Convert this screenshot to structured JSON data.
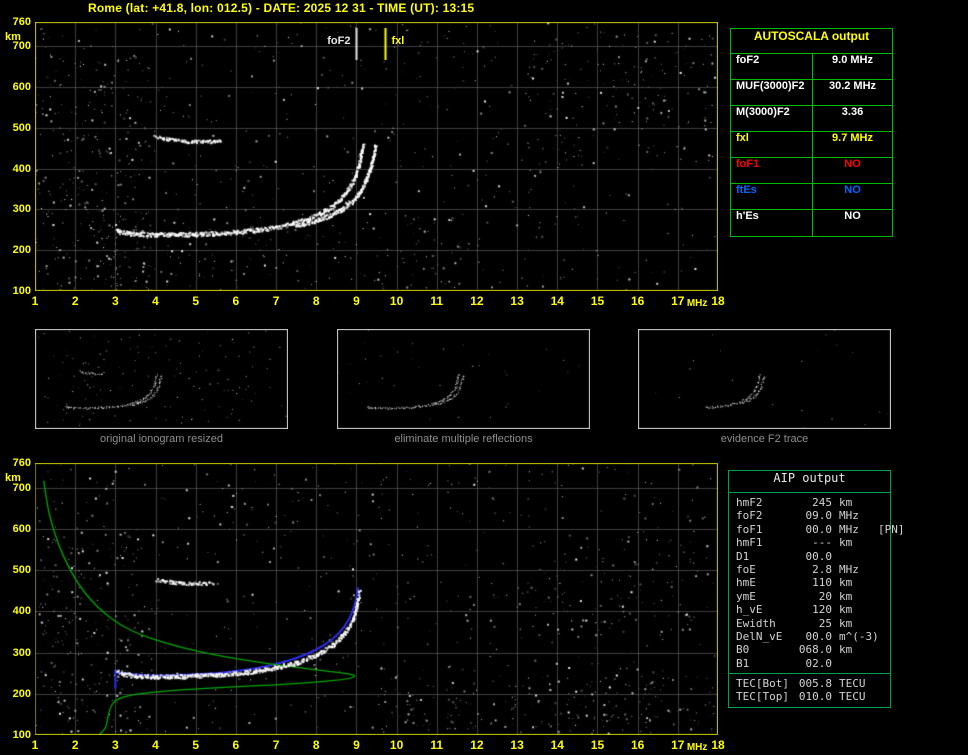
{
  "title": "Rome (lat: +41.8, lon: 012.5) - DATE: 2025 12 31 - TIME (UT): 13:15",
  "colors": {
    "accent_yellow": "#ffff00",
    "table_green": "#00bb00",
    "trace_blue": "#2e2ef0",
    "profile_green": "#00a800",
    "plot_border": "#cdcd00",
    "status_red": "#ff0000",
    "status_blue": "#0066ff"
  },
  "autoscala_table": {
    "header": "AUTOSCALA output",
    "rows": [
      {
        "label": "foF2",
        "value": "9.0 MHz",
        "color": "#ffffff"
      },
      {
        "label": "MUF(3000)F2",
        "value": "30.2 MHz",
        "color": "#ffffff"
      },
      {
        "label": "M(3000)F2",
        "value": "3.36",
        "color": "#ffffff"
      },
      {
        "label": "fxl",
        "value": "9.7 MHz",
        "color": "#ffff00"
      },
      {
        "label": "foF1",
        "value": "NO",
        "color": "#ff0000"
      },
      {
        "label": "ftEs",
        "value": "NO",
        "color": "#0066ff"
      },
      {
        "label": "h'Es",
        "value": "NO",
        "color": "#ffffff"
      }
    ]
  },
  "aip_table": {
    "header": "AIP output",
    "rows": [
      {
        "label": "hmF2",
        "value": "245",
        "unit": "km",
        "extra": ""
      },
      {
        "label": "foF2",
        "value": "09.0",
        "unit": "MHz",
        "extra": ""
      },
      {
        "label": "foF1",
        "value": "00.0",
        "unit": "MHz",
        "extra": "[PN]"
      },
      {
        "label": "hmF1",
        "value": "---",
        "unit": "km",
        "extra": ""
      },
      {
        "label": "D1",
        "value": "00.0",
        "unit": "",
        "extra": ""
      },
      {
        "label": "foE",
        "value": "2.8",
        "unit": "MHz",
        "extra": ""
      },
      {
        "label": "hmE",
        "value": "110",
        "unit": "km",
        "extra": ""
      },
      {
        "label": "ymE",
        "value": "20",
        "unit": "km",
        "extra": ""
      },
      {
        "label": "h_vE",
        "value": "120",
        "unit": "km",
        "extra": ""
      },
      {
        "label": "Ewidth",
        "value": "25",
        "unit": "km",
        "extra": ""
      },
      {
        "label": "DelN_vE",
        "value": "00.0",
        "unit": "m^(-3)",
        "extra": ""
      },
      {
        "label": "B0",
        "value": "068.0",
        "unit": "km",
        "extra": ""
      },
      {
        "label": "B1",
        "value": "02.0",
        "unit": "",
        "extra": ""
      }
    ],
    "tec_rows": [
      {
        "label": "TEC[Bot]",
        "value": "005.8",
        "unit": "TECU",
        "extra": ""
      },
      {
        "label": "TEC[Top]",
        "value": "010.0",
        "unit": "TECU",
        "extra": ""
      }
    ]
  },
  "thumbnails": [
    {
      "caption": "original ionogram resized"
    },
    {
      "caption": "eliminate multiple reflections"
    },
    {
      "caption": "evidence F2 trace"
    }
  ],
  "chart_data": [
    {
      "id": "ionogram",
      "type": "scatter",
      "title": "Ionogram with AUTOSCALA scaling",
      "xlabel": "MHz",
      "ylabel": "km",
      "xlim": [
        1,
        18
      ],
      "ylim": [
        100,
        760
      ],
      "xticks": [
        1,
        2,
        3,
        4,
        5,
        6,
        7,
        8,
        9,
        10,
        11,
        12,
        13,
        14,
        15,
        16,
        17,
        18
      ],
      "yticks": [
        100,
        200,
        300,
        400,
        500,
        600,
        700,
        760
      ],
      "grid": true,
      "markers": [
        {
          "label": "foF2",
          "freq_mhz": 9.0,
          "color": "#e6e6e6",
          "label_side": "left"
        },
        {
          "label": "fxl",
          "freq_mhz": 9.7,
          "color": "#ffff00",
          "label_side": "right"
        }
      ],
      "series": [
        {
          "name": "F2 O-mode trace",
          "color": "#ffffff",
          "style": "speckle",
          "points": [
            [
              3.02,
              252
            ],
            [
              3.1,
              246
            ],
            [
              3.3,
              243
            ],
            [
              3.6,
              241
            ],
            [
              4.0,
              240
            ],
            [
              4.5,
              240
            ],
            [
              5.0,
              241
            ],
            [
              5.5,
              243
            ],
            [
              6.0,
              246
            ],
            [
              6.5,
              251
            ],
            [
              7.0,
              258
            ],
            [
              7.4,
              267
            ],
            [
              7.8,
              279
            ],
            [
              8.1,
              292
            ],
            [
              8.4,
              310
            ],
            [
              8.6,
              328
            ],
            [
              8.8,
              352
            ],
            [
              8.95,
              380
            ],
            [
              9.05,
              412
            ],
            [
              9.12,
              445
            ],
            [
              9.16,
              462
            ]
          ]
        },
        {
          "name": "F2 X-mode trace",
          "color": "#ffffff",
          "style": "speckle",
          "points": [
            [
              7.5,
              262
            ],
            [
              7.9,
              272
            ],
            [
              8.3,
              285
            ],
            [
              8.6,
              300
            ],
            [
              8.9,
              322
            ],
            [
              9.1,
              348
            ],
            [
              9.25,
              378
            ],
            [
              9.35,
              408
            ],
            [
              9.42,
              436
            ],
            [
              9.46,
              456
            ]
          ]
        },
        {
          "name": "second reflection",
          "color": "#ffffff",
          "style": "speckle",
          "thin": true,
          "points": [
            [
              3.95,
              482
            ],
            [
              4.2,
              476
            ],
            [
              4.5,
              471
            ],
            [
              4.9,
              468
            ],
            [
              5.3,
              468
            ],
            [
              5.6,
              471
            ]
          ]
        },
        {
          "name": "E-region spread",
          "color": "#ffffff",
          "style": "speckle",
          "sparse": true,
          "points": [
            [
              3.0,
              250
            ],
            [
              3.02,
              160
            ],
            [
              3.03,
              108
            ]
          ]
        }
      ]
    },
    {
      "id": "profile",
      "type": "scatter",
      "title": "Restored trace with AIP electron density profile",
      "xlabel": "MHz",
      "ylabel": "km",
      "xlim": [
        1,
        18
      ],
      "ylim": [
        100,
        760
      ],
      "xticks": [
        1,
        2,
        3,
        4,
        5,
        6,
        7,
        8,
        9,
        10,
        11,
        12,
        13,
        14,
        15,
        16,
        17,
        18
      ],
      "yticks": [
        100,
        200,
        300,
        400,
        500,
        600,
        700,
        760
      ],
      "grid": true,
      "series": [
        {
          "name": "fitted trace",
          "color": "#2e2ef0",
          "style": "line",
          "width": 2,
          "points": [
            [
              3.0,
              252
            ],
            [
              3.5,
              246
            ],
            [
              4.0,
              244
            ],
            [
              4.5,
              245
            ],
            [
              5.0,
              247
            ],
            [
              5.5,
              250
            ],
            [
              6.0,
              255
            ],
            [
              6.5,
              262
            ],
            [
              7.0,
              272
            ],
            [
              7.5,
              286
            ],
            [
              8.0,
              306
            ],
            [
              8.4,
              331
            ],
            [
              8.7,
              361
            ],
            [
              8.9,
              396
            ],
            [
              9.0,
              431
            ],
            [
              9.04,
              456
            ]
          ]
        },
        {
          "name": "E onset",
          "color": "#2e2ef0",
          "style": "line",
          "width": 2,
          "points": [
            [
              3.0,
              258
            ],
            [
              3.0,
              214
            ]
          ]
        },
        {
          "name": "electron density profile",
          "color": "#00a800",
          "style": "line",
          "width": 1.3,
          "points": [
            [
              1.22,
              716
            ],
            [
              1.3,
              660
            ],
            [
              1.42,
              610
            ],
            [
              1.6,
              558
            ],
            [
              1.82,
              510
            ],
            [
              2.08,
              466
            ],
            [
              2.38,
              428
            ],
            [
              2.72,
              396
            ],
            [
              3.1,
              368
            ],
            [
              3.6,
              344
            ],
            [
              4.3,
              321
            ],
            [
              5.2,
              299
            ],
            [
              6.3,
              280
            ],
            [
              7.4,
              265
            ],
            [
              8.3,
              255
            ],
            [
              8.85,
              248
            ],
            [
              9.0,
              243
            ],
            [
              8.8,
              236
            ],
            [
              8.1,
              229
            ],
            [
              7.0,
              222
            ],
            [
              5.8,
              216
            ],
            [
              4.7,
              210
            ],
            [
              3.8,
              203
            ],
            [
              3.3,
              195
            ],
            [
              3.02,
              186
            ],
            [
              2.9,
              172
            ],
            [
              2.84,
              156
            ],
            [
              2.8,
              134
            ],
            [
              2.76,
              118
            ],
            [
              2.68,
              108
            ],
            [
              2.6,
              101
            ]
          ]
        },
        {
          "name": "restored F2 trace",
          "color": "#ffffff",
          "style": "speckle",
          "points": [
            [
              3.05,
              256
            ],
            [
              3.2,
              249
            ],
            [
              3.5,
              245
            ],
            [
              4.0,
              243
            ],
            [
              4.5,
              243
            ],
            [
              5.0,
              245
            ],
            [
              5.5,
              247
            ],
            [
              6.0,
              251
            ],
            [
              6.5,
              257
            ],
            [
              7.0,
              265
            ],
            [
              7.5,
              277
            ],
            [
              8.0,
              295
            ],
            [
              8.4,
              319
            ],
            [
              8.7,
              349
            ],
            [
              8.9,
              383
            ],
            [
              9.0,
              416
            ],
            [
              9.06,
              448
            ]
          ]
        },
        {
          "name": "second reflection",
          "color": "#ffffff",
          "style": "speckle",
          "thin": true,
          "points": [
            [
              4.0,
              478
            ],
            [
              4.4,
              472
            ],
            [
              4.9,
              469
            ],
            [
              5.4,
              470
            ]
          ]
        },
        {
          "name": "E-region segment",
          "color": "#ffffff",
          "style": "speckle",
          "sparse": true,
          "points": [
            [
              2.95,
              282
            ],
            [
              3.0,
              238
            ]
          ]
        }
      ]
    }
  ]
}
